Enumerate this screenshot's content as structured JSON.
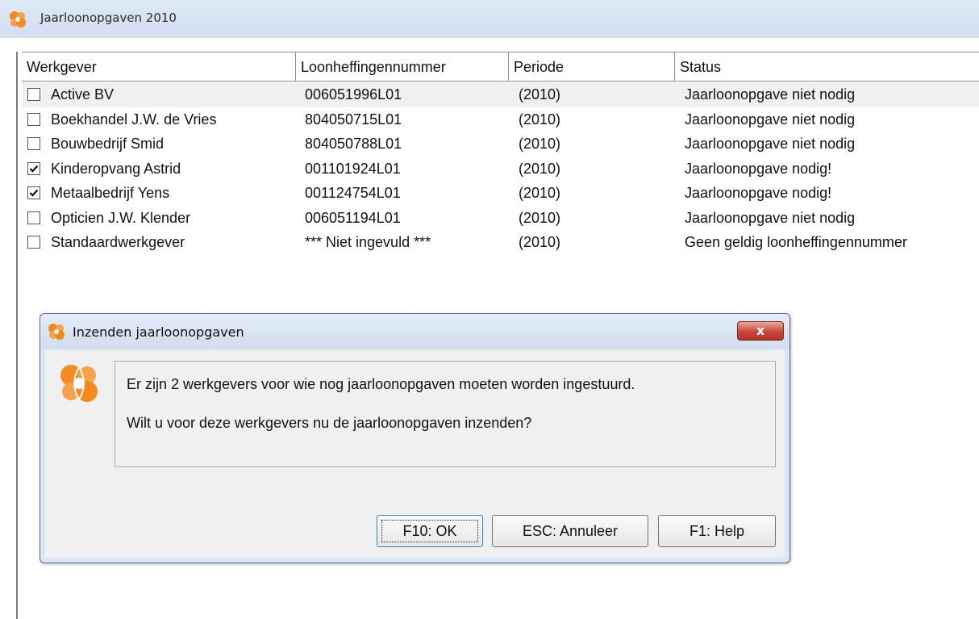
{
  "window": {
    "title": "Jaarloonopgaven 2010"
  },
  "grid": {
    "columns": [
      "Werkgever",
      "Loonheffingennummer",
      "Periode",
      "Status"
    ],
    "rows": [
      {
        "employer": "Active BV",
        "number": "006051996L01",
        "period": "(2010)",
        "status": "Jaarloonopgave niet nodig",
        "checked": false
      },
      {
        "employer": "Boekhandel J.W. de Vries",
        "number": "804050715L01",
        "period": "(2010)",
        "status": "Jaarloonopgave niet nodig",
        "checked": false
      },
      {
        "employer": "Bouwbedrijf Smid",
        "number": "804050788L01",
        "period": "(2010)",
        "status": "Jaarloonopgave niet nodig",
        "checked": false
      },
      {
        "employer": "Kinderopvang Astrid",
        "number": "001101924L01",
        "period": "(2010)",
        "status": "Jaarloonopgave nodig!",
        "checked": true
      },
      {
        "employer": "Metaalbedrijf Yens",
        "number": "001124754L01",
        "period": "(2010)",
        "status": "Jaarloonopgave nodig!",
        "checked": true
      },
      {
        "employer": "Opticien J.W. Klender",
        "number": "006051194L01",
        "period": "(2010)",
        "status": "Jaarloonopgave niet nodig",
        "checked": false
      },
      {
        "employer": "Standaardwerkgever",
        "number": "*** Niet ingevuld ***",
        "period": "(2010)",
        "status": "Geen geldig loonheffingennummer",
        "checked": false
      }
    ]
  },
  "dialog": {
    "title": "Inzenden jaarloonopgaven",
    "close_label": "x",
    "message_line1": "Er zijn 2 werkgevers voor wie nog jaarloonopgaven moeten worden ingestuurd.",
    "message_line2": "Wilt u voor deze werkgevers nu de jaarloonopgaven inzenden?",
    "ok_label": "F10: OK",
    "cancel_label": "ESC: Annuleer",
    "help_label": "F1: Help"
  },
  "colors": {
    "logo_orange": "#f28a1d",
    "close_red": "#c8473a"
  }
}
